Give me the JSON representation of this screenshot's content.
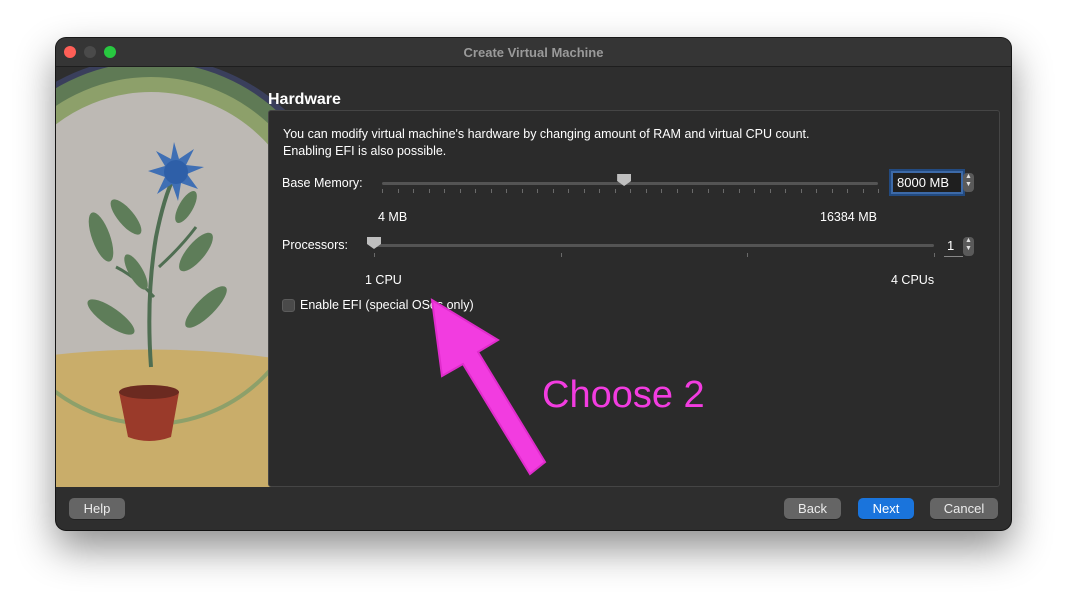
{
  "window": {
    "title": "Create Virtual Machine"
  },
  "section": {
    "title": "Hardware"
  },
  "description": {
    "line1": "You can modify virtual machine's hardware by changing amount of RAM and virtual CPU count.",
    "line2": "Enabling EFI is also possible."
  },
  "memory": {
    "label": "Base Memory:",
    "value": "8000 MB",
    "min_label": "4 MB",
    "max_label": "16384 MB",
    "min": 4,
    "max": 16384,
    "current": 8000
  },
  "processors": {
    "label": "Processors:",
    "value": "1",
    "min_label": "1 CPU",
    "max_label": "4 CPUs",
    "min": 1,
    "max": 4,
    "current": 1
  },
  "efi": {
    "label": "Enable EFI (special OSes only)",
    "checked": false
  },
  "buttons": {
    "help": "Help",
    "back": "Back",
    "next": "Next",
    "cancel": "Cancel"
  },
  "annotation": {
    "text": "Choose 2",
    "color": "#f23ce0"
  },
  "colors": {
    "primary_button": "#1a74dc",
    "window_bg": "#2e2e2e"
  },
  "icons": [
    "close-light",
    "minimize-light",
    "zoom-light",
    "spin-up-icon",
    "spin-down-icon",
    "annotation-arrow"
  ]
}
